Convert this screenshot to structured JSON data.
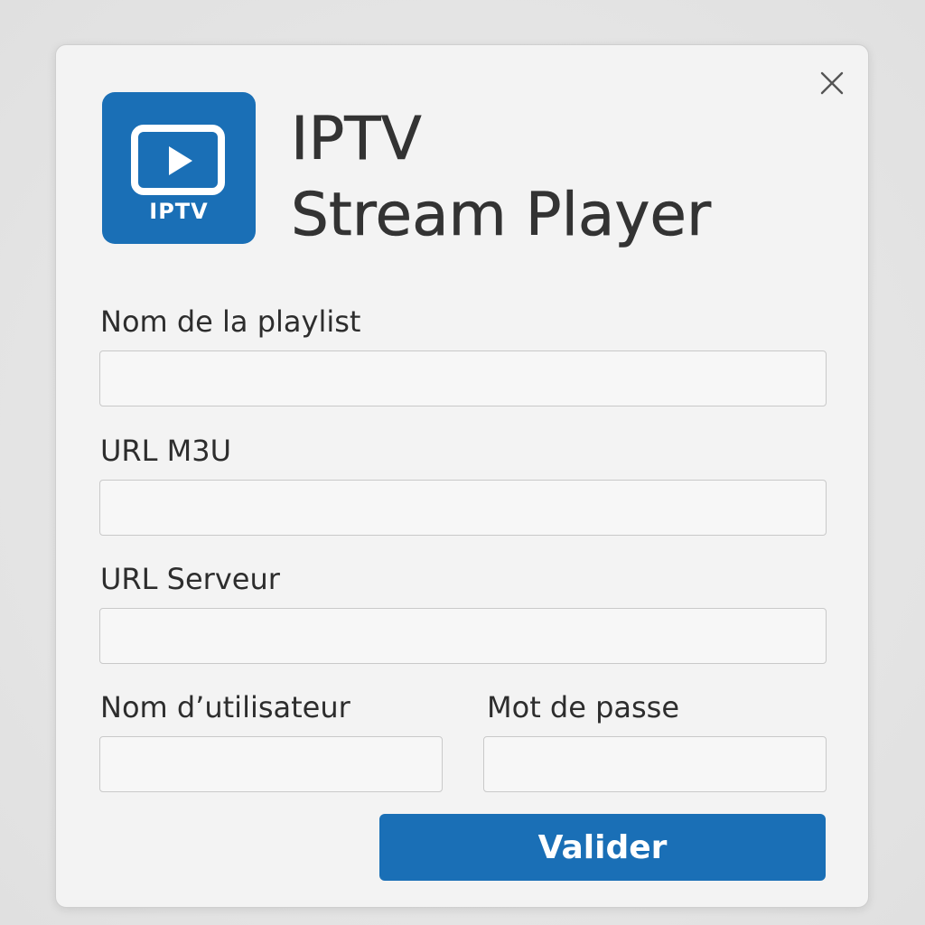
{
  "app": {
    "title_line1": "IPTV",
    "title_line2": "Stream Player",
    "logo_text": "IPTV",
    "logo_icon": "play-screen-icon",
    "accent_color": "#1a6fb6"
  },
  "dialog": {
    "close_icon": "close-icon"
  },
  "form": {
    "playlist_name": {
      "label": "Nom de la playlist",
      "value": "",
      "placeholder": ""
    },
    "m3u_url": {
      "label": "URL M3U",
      "value": "",
      "placeholder": ""
    },
    "server_url": {
      "label": "URL Serveur",
      "value": "",
      "placeholder": ""
    },
    "username": {
      "label": "Nom d’utilisateur",
      "value": "",
      "placeholder": ""
    },
    "password": {
      "label": "Mot de passe",
      "value": "",
      "placeholder": ""
    },
    "submit_label": "Valider"
  }
}
